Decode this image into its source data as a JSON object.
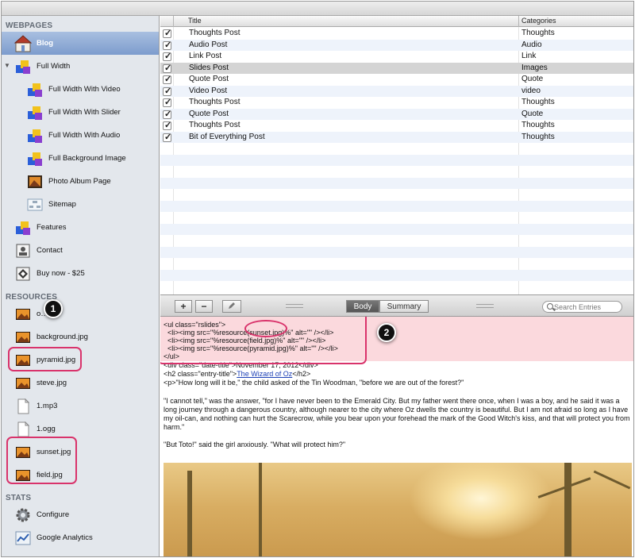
{
  "sidebar": {
    "sections": {
      "webpages": "WEBPAGES",
      "resources": "RESOURCES",
      "stats": "STATS"
    },
    "webpages": [
      {
        "label": "Blog",
        "icon": "home-icon",
        "selected": true
      },
      {
        "label": "Full Width",
        "icon": "blocks-icon"
      },
      {
        "label": "Full Width With Video",
        "icon": "blocks-icon"
      },
      {
        "label": "Full Width With Slider",
        "icon": "blocks-icon"
      },
      {
        "label": "Full Width With Audio",
        "icon": "blocks-icon"
      },
      {
        "label": "Full Background Image",
        "icon": "blocks-icon"
      },
      {
        "label": "Photo Album Page",
        "icon": "photo-album-icon"
      },
      {
        "label": "Sitemap",
        "icon": "sitemap-icon"
      },
      {
        "label": "Features",
        "icon": "blocks-icon"
      },
      {
        "label": "Contact",
        "icon": "contact-icon"
      },
      {
        "label": "Buy now - $25",
        "icon": "buy-icon"
      }
    ],
    "resources": [
      {
        "label": "o…pg",
        "icon": "image-file-icon"
      },
      {
        "label": "background.jpg",
        "icon": "image-file-icon"
      },
      {
        "label": "pyramid.jpg",
        "icon": "image-file-icon"
      },
      {
        "label": "steve.jpg",
        "icon": "image-file-icon"
      },
      {
        "label": "1.mp3",
        "icon": "document-file-icon"
      },
      {
        "label": "1.ogg",
        "icon": "document-file-icon"
      },
      {
        "label": "sunset.jpg",
        "icon": "image-file-icon"
      },
      {
        "label": "field.jpg",
        "icon": "image-file-icon"
      }
    ],
    "stats": [
      {
        "label": "Configure",
        "icon": "gear-icon"
      },
      {
        "label": "Google Analytics",
        "icon": "analytics-icon"
      }
    ]
  },
  "table": {
    "columns": {
      "title": "Title",
      "categories": "Categories"
    },
    "rows": [
      {
        "title": "Thoughts Post",
        "category": "Thoughts",
        "checked": true
      },
      {
        "title": "Audio Post",
        "category": "Audio",
        "checked": true
      },
      {
        "title": "Link Post",
        "category": "Link",
        "checked": true
      },
      {
        "title": "Slides Post",
        "category": "Images",
        "checked": true,
        "selected": true
      },
      {
        "title": "Quote Post",
        "category": "Quote",
        "checked": true
      },
      {
        "title": "Video Post",
        "category": "video",
        "checked": true
      },
      {
        "title": "Thoughts Post",
        "category": "Thoughts",
        "checked": true
      },
      {
        "title": "Quote Post",
        "category": "Quote",
        "checked": true
      },
      {
        "title": "Thoughts Post",
        "category": "Thoughts",
        "checked": true
      },
      {
        "title": "Bit of Everything Post",
        "category": "Thoughts",
        "checked": true
      }
    ]
  },
  "toolbar": {
    "add_label": "+",
    "remove_label": "−",
    "body_tab": "Body",
    "summary_tab": "Summary",
    "search_placeholder": "Search Entries"
  },
  "callouts": {
    "one": "1",
    "two": "2"
  },
  "editor": {
    "code_lines": [
      "<ul class=\"rslides\">",
      "  <li><img src=\"%resource(sunset.jpg)%\" alt=\"\" /></li>",
      "  <li><img src=\"%resource(field.jpg)%\" alt=\"\" /></li>",
      "  <li><img src=\"%resource(pyramid.jpg)%\" alt=\"\" /></li>",
      "</ul>",
      "<div class=\"date-title\">November 17, 2012</div>"
    ],
    "h2_open": "<h2 class=\"entry-title\">",
    "h2_link": "The Wizard of Oz",
    "h2_close": "</h2>",
    "p1": "<p>\"How long will it be,\" the child asked of the Tin Woodman, \"before we are out of the forest?\"",
    "p2": "\"I cannot tell,\" was the answer, \"for I have never been to the Emerald City.  But my father went there once, when I was a boy, and he said it was a long journey through a dangerous country, although nearer to the city where Oz dwells the country is beautiful.  But I am not afraid so long as I have my oil-can, and nothing can hurt the Scarecrow, while you bear upon your forehead the mark of the Good Witch's kiss, and that will protect you from harm.\"",
    "p3": "\"But Toto!\" said the girl anxiously.  \"What will protect him?\""
  },
  "colors": {
    "highlight": "#d9336b",
    "selection": "#7d9ccd",
    "code_highlight_bg": "#fbd9dd"
  }
}
